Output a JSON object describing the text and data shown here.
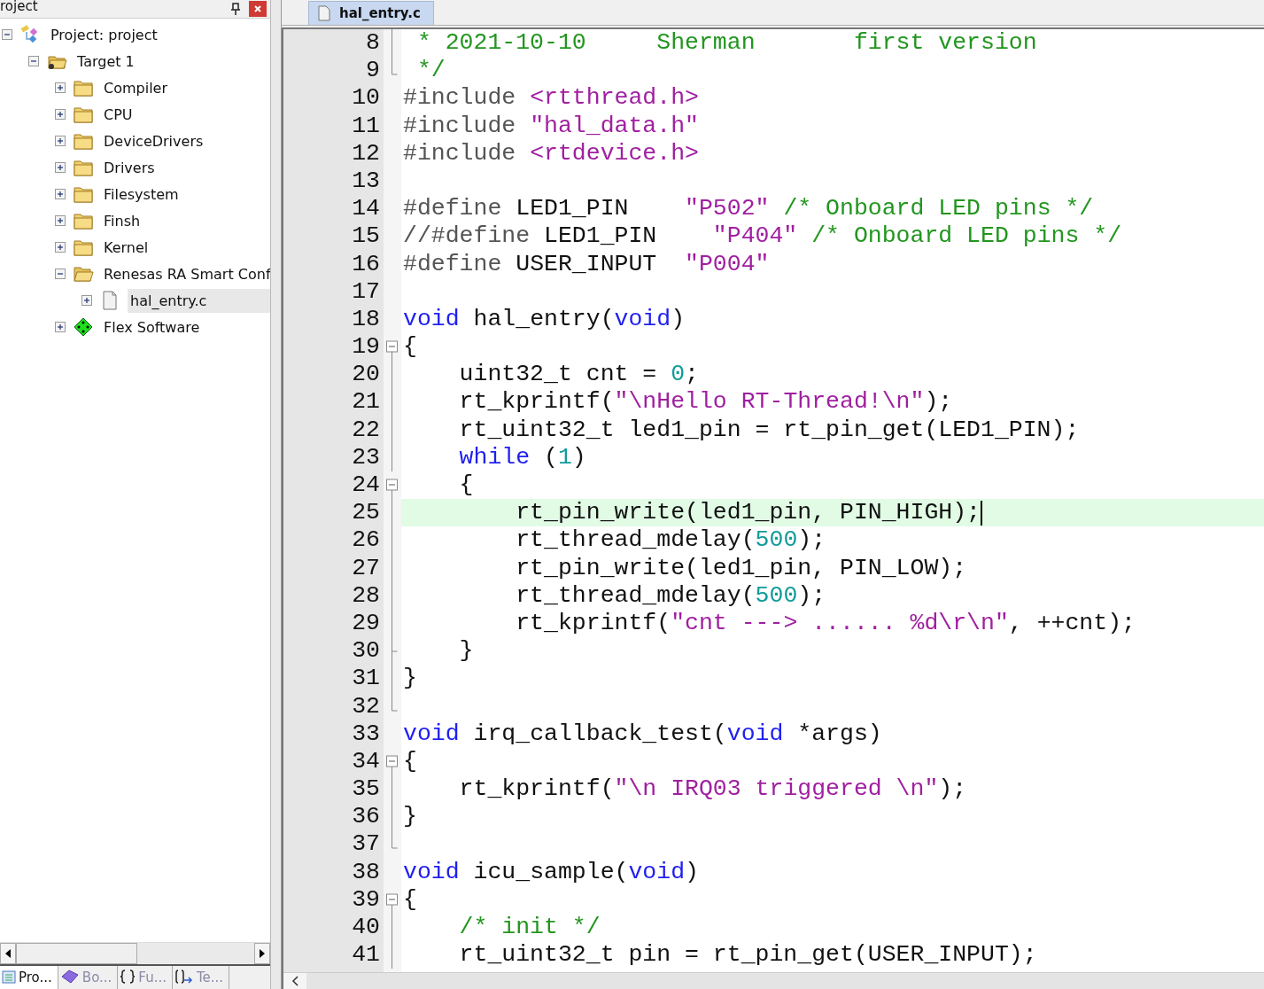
{
  "project_panel": {
    "title": "roject",
    "tree": [
      {
        "label": "Project: project",
        "kind": "project",
        "expanded": true,
        "selected": false,
        "children": [
          {
            "label": "Target 1",
            "kind": "target",
            "expanded": true,
            "selected": false,
            "children": [
              {
                "label": "Compiler",
                "kind": "folder",
                "expanded": false,
                "selected": false
              },
              {
                "label": "CPU",
                "kind": "folder",
                "expanded": false,
                "selected": false
              },
              {
                "label": "DeviceDrivers",
                "kind": "folder",
                "expanded": false,
                "selected": false
              },
              {
                "label": "Drivers",
                "kind": "folder",
                "expanded": false,
                "selected": false
              },
              {
                "label": "Filesystem",
                "kind": "folder",
                "expanded": false,
                "selected": false
              },
              {
                "label": "Finsh",
                "kind": "folder",
                "expanded": false,
                "selected": false
              },
              {
                "label": "Kernel",
                "kind": "folder",
                "expanded": false,
                "selected": false
              },
              {
                "label": "Renesas RA Smart Conf",
                "kind": "folder",
                "expanded": true,
                "selected": false,
                "children": [
                  {
                    "label": "hal_entry.c",
                    "kind": "file",
                    "expanded": false,
                    "selected": true
                  }
                ]
              },
              {
                "label": "Flex Software",
                "kind": "component",
                "expanded": false,
                "selected": false
              }
            ]
          }
        ]
      }
    ],
    "tabs": [
      {
        "label": "Pro...",
        "kind": "project",
        "selected": true
      },
      {
        "label": "Bo...",
        "kind": "book",
        "selected": false
      },
      {
        "label": "Fu...",
        "kind": "braces",
        "selected": false
      },
      {
        "label": "Te...",
        "kind": "template",
        "selected": false
      }
    ]
  },
  "editor": {
    "tabs": [
      {
        "label": "hal_entry.c",
        "selected": true
      }
    ],
    "lines": [
      {
        "number": "8",
        "kind": "fold-body",
        "tokens": [
          {
            "kind": "comment",
            "text": " * 2021-10-10     Sherman       first version"
          }
        ]
      },
      {
        "number": "9",
        "kind": "fold-end",
        "tokens": [
          {
            "kind": "comment",
            "text": " */"
          }
        ]
      },
      {
        "number": "10",
        "kind": "plain",
        "tokens": [
          {
            "kind": "preproc",
            "text": "#include "
          },
          {
            "kind": "string",
            "text": "<rtthread.h>"
          }
        ]
      },
      {
        "number": "11",
        "kind": "plain",
        "tokens": [
          {
            "kind": "preproc",
            "text": "#include "
          },
          {
            "kind": "string",
            "text": "\"hal_data.h\""
          }
        ]
      },
      {
        "number": "12",
        "kind": "plain",
        "tokens": [
          {
            "kind": "preproc",
            "text": "#include "
          },
          {
            "kind": "string",
            "text": "<rtdevice.h>"
          }
        ]
      },
      {
        "number": "13",
        "kind": "plain"
      },
      {
        "number": "14",
        "kind": "plain",
        "tokens": [
          {
            "kind": "preproc",
            "text": "#define"
          },
          {
            "kind": "plain",
            "text": " LED1_PIN    "
          },
          {
            "kind": "string",
            "text": "\"P502\" "
          },
          {
            "kind": "comment",
            "text": "/* Onboard LED pins */"
          }
        ]
      },
      {
        "number": "15",
        "kind": "plain",
        "tokens": [
          {
            "kind": "preproc",
            "text": "//#define"
          },
          {
            "kind": "plain",
            "text": " LED1_PIN    "
          },
          {
            "kind": "string",
            "text": "\"P404\" "
          },
          {
            "kind": "comment",
            "text": "/* Onboard LED pins */"
          }
        ]
      },
      {
        "number": "16",
        "kind": "plain",
        "tokens": [
          {
            "kind": "preproc",
            "text": "#define"
          },
          {
            "kind": "plain",
            "text": " USER_INPUT  "
          },
          {
            "kind": "string",
            "text": "\"P004\""
          }
        ]
      },
      {
        "number": "17",
        "kind": "plain"
      },
      {
        "number": "18",
        "kind": "plain",
        "tokens": [
          {
            "kind": "keyword",
            "text": "void"
          },
          {
            "kind": "plain",
            "text": " hal_entry("
          },
          {
            "kind": "keyword",
            "text": "void"
          },
          {
            "kind": "plain",
            "text": ")"
          }
        ]
      },
      {
        "number": "19",
        "kind": "fold-start",
        "tokens": [
          {
            "kind": "plain",
            "text": "{"
          }
        ]
      },
      {
        "number": "20",
        "kind": "fold-body",
        "tokens": [
          {
            "kind": "plain",
            "text": "    uint32_t cnt = "
          },
          {
            "kind": "number",
            "text": "0"
          },
          {
            "kind": "plain",
            "text": ";"
          }
        ]
      },
      {
        "number": "21",
        "kind": "fold-body",
        "tokens": [
          {
            "kind": "plain",
            "text": "    rt_kprintf("
          },
          {
            "kind": "string",
            "text": "\"\\nHello RT-Thread!\\n\""
          },
          {
            "kind": "plain",
            "text": ");"
          }
        ]
      },
      {
        "number": "22",
        "kind": "fold-body",
        "tokens": [
          {
            "kind": "plain",
            "text": "    rt_uint32_t led1_pin = rt_pin_get(LED1_PIN);"
          }
        ]
      },
      {
        "number": "23",
        "kind": "fold-body",
        "tokens": [
          {
            "kind": "keyword",
            "text": "    while"
          },
          {
            "kind": "plain",
            "text": " ("
          },
          {
            "kind": "number",
            "text": "1"
          },
          {
            "kind": "plain",
            "text": ")"
          }
        ]
      },
      {
        "number": "24",
        "kind": "fold-start",
        "tokens": [
          {
            "kind": "plain",
            "text": "    {"
          }
        ]
      },
      {
        "number": "25",
        "kind": "fold-body",
        "current": true,
        "tokens": [
          {
            "kind": "plain",
            "text": "        rt_pin_write(led1_pin, PIN_HIGH);"
          }
        ]
      },
      {
        "number": "26",
        "kind": "fold-body",
        "current": false,
        "tokens": [
          {
            "kind": "plain",
            "text": "        rt_thread_mdelay("
          },
          {
            "kind": "number",
            "text": "500"
          },
          {
            "kind": "plain",
            "text": ");"
          }
        ]
      },
      {
        "number": "27",
        "kind": "fold-body",
        "tokens": [
          {
            "kind": "plain",
            "text": "        rt_pin_write(led1_pin, PIN_LOW);"
          }
        ]
      },
      {
        "number": "28",
        "kind": "fold-body",
        "tokens": [
          {
            "kind": "plain",
            "text": "        rt_thread_mdelay("
          },
          {
            "kind": "number",
            "text": "500"
          },
          {
            "kind": "plain",
            "text": ");"
          }
        ]
      },
      {
        "number": "29",
        "kind": "fold-body",
        "tokens": [
          {
            "kind": "plain",
            "text": "        rt_kprintf("
          },
          {
            "kind": "string",
            "text": "\"cnt ---> ...... %d\\r\\n\""
          },
          {
            "kind": "plain",
            "text": ", ++cnt);"
          }
        ]
      },
      {
        "number": "30",
        "kind": "fold-branch",
        "tokens": [
          {
            "kind": "plain",
            "text": "    }"
          }
        ]
      },
      {
        "number": "31",
        "kind": "fold-body",
        "tokens": [
          {
            "kind": "plain",
            "text": "}"
          }
        ]
      },
      {
        "number": "32",
        "kind": "fold-end"
      },
      {
        "number": "33",
        "kind": "plain",
        "tokens": [
          {
            "kind": "keyword",
            "text": "void"
          },
          {
            "kind": "plain",
            "text": " irq_callback_test("
          },
          {
            "kind": "keyword",
            "text": "void"
          },
          {
            "kind": "plain",
            "text": " *args)"
          }
        ]
      },
      {
        "number": "34",
        "kind": "fold-start",
        "tokens": [
          {
            "kind": "plain",
            "text": "{"
          }
        ]
      },
      {
        "number": "35",
        "kind": "fold-body",
        "tokens": [
          {
            "kind": "plain",
            "text": "    rt_kprintf("
          },
          {
            "kind": "string",
            "text": "\"\\n IRQ03 triggered \\n\""
          },
          {
            "kind": "plain",
            "text": ");"
          }
        ]
      },
      {
        "number": "36",
        "kind": "fold-body",
        "tokens": [
          {
            "kind": "plain",
            "text": "}"
          }
        ]
      },
      {
        "number": "37",
        "kind": "fold-end"
      },
      {
        "number": "38",
        "kind": "plain",
        "tokens": [
          {
            "kind": "keyword",
            "text": "void"
          },
          {
            "kind": "plain",
            "text": " icu_sample("
          },
          {
            "kind": "keyword",
            "text": "void"
          },
          {
            "kind": "plain",
            "text": ")"
          }
        ]
      },
      {
        "number": "39",
        "kind": "fold-start",
        "tokens": [
          {
            "kind": "plain",
            "text": "{"
          }
        ]
      },
      {
        "number": "40",
        "kind": "fold-body",
        "tokens": [
          {
            "kind": "comment",
            "text": "    /* init */"
          }
        ]
      },
      {
        "number": "41",
        "kind": "fold-body",
        "tokens": [
          {
            "kind": "plain",
            "text": "    rt_uint32_t pin = rt_pin_get(USER_INPUT);"
          }
        ]
      }
    ]
  }
}
